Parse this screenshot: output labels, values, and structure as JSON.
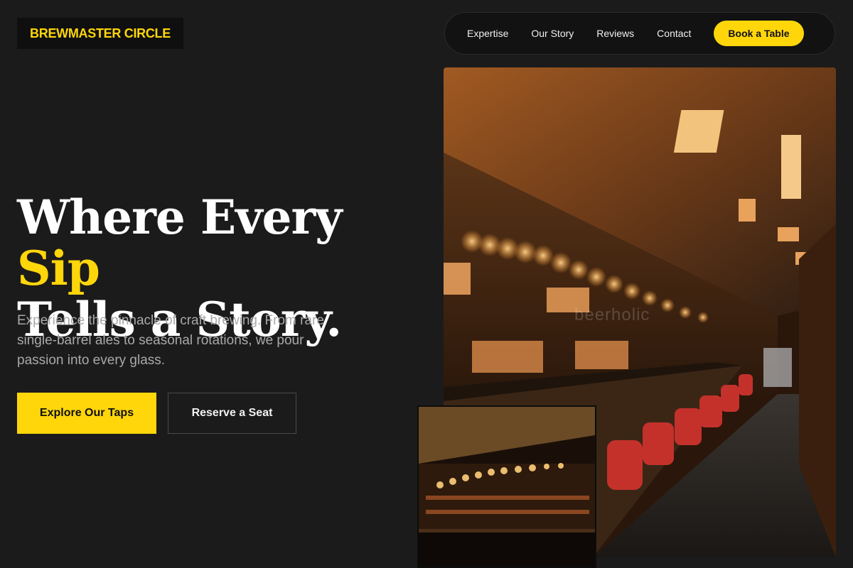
{
  "brand": {
    "logo_text": "BREWMASTER CIRCLE"
  },
  "nav": {
    "links": [
      "Expertise",
      "Our Story",
      "Reviews",
      "Contact"
    ],
    "cta_label": "Book a Table"
  },
  "hero": {
    "headline_part1": "Where Every ",
    "headline_accent": "Sip",
    "headline_part2": "Tells a Story.",
    "subtext": "Experience the pinnacle of craft brewing. From rare single-barrel ales to seasonal rotations, we pour passion into every glass.",
    "primary_button": "Explore Our Taps",
    "secondary_button": "Reserve a Seat"
  },
  "images": {
    "watermark_text": "beerholic"
  },
  "colors": {
    "background": "#1b1b1b",
    "accent": "#ffd60a",
    "nav_background": "#121212"
  }
}
